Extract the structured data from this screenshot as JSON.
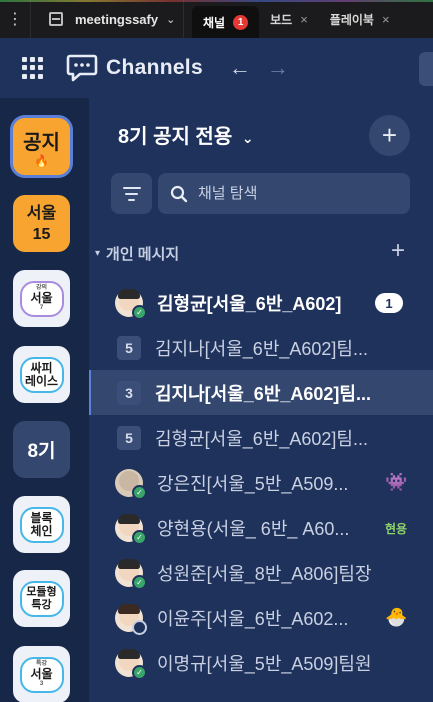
{
  "tabbar": {
    "workspace": "meetingssafy",
    "tabs": [
      {
        "label": "채널",
        "badge": "1",
        "active": true
      },
      {
        "label": "보드",
        "close": "×"
      },
      {
        "label": "플레이북",
        "close": "×"
      }
    ]
  },
  "header": {
    "title": "Channels",
    "back": "←",
    "forward": "→"
  },
  "rail": {
    "items": [
      {
        "label": "공지",
        "extra": "🔥"
      },
      {
        "label": "서울",
        "sub": "15"
      },
      {
        "label": "서울",
        "tiny": "강의",
        "sub": "7"
      },
      {
        "label": "싸피",
        "sub": "레이스"
      },
      {
        "label": "8기"
      },
      {
        "label": "블록",
        "sub": "체인"
      },
      {
        "label": "모듈형",
        "sub": "특강"
      },
      {
        "label": "서울",
        "tiny": "특강",
        "sub": "3"
      }
    ]
  },
  "main": {
    "team_title": "8기 공지 전용",
    "caret": "⌄",
    "add": "+",
    "search_placeholder": "채널 탐색",
    "section_label": "개인 메시지",
    "section_add": "+",
    "rows": [
      {
        "name": "김형균[서울_6반_A602]",
        "unread": "1",
        "kind": "avatar"
      },
      {
        "name": "김지나[서울_6반_A602]팀...",
        "count": "5",
        "kind": "group"
      },
      {
        "name": "김지나[서울_6반_A602]팀...",
        "count": "3",
        "kind": "group"
      },
      {
        "name": "김형균[서울_6반_A602]팀...",
        "count": "5",
        "kind": "group"
      },
      {
        "name": "강은진[서울_5반_A509...",
        "kind": "avatar",
        "emoji": "👾"
      },
      {
        "name": "양현용(서울_ 6반_ A60...",
        "kind": "avatar",
        "emoji_text": "현용"
      },
      {
        "name": "성원준[서울_8반_A806]팀장",
        "kind": "avatar"
      },
      {
        "name": "이윤주[서울_6반_A602...",
        "kind": "avatar",
        "status": "away",
        "emoji": "🐣"
      },
      {
        "name": "이명규[서울_5반_A509]팀원",
        "kind": "avatar"
      }
    ]
  },
  "colors": {
    "bg": "#1e325c",
    "rail": "#172748",
    "active_row": "#34476e",
    "online": "#3aa56a",
    "badge_red": "#e53935"
  }
}
